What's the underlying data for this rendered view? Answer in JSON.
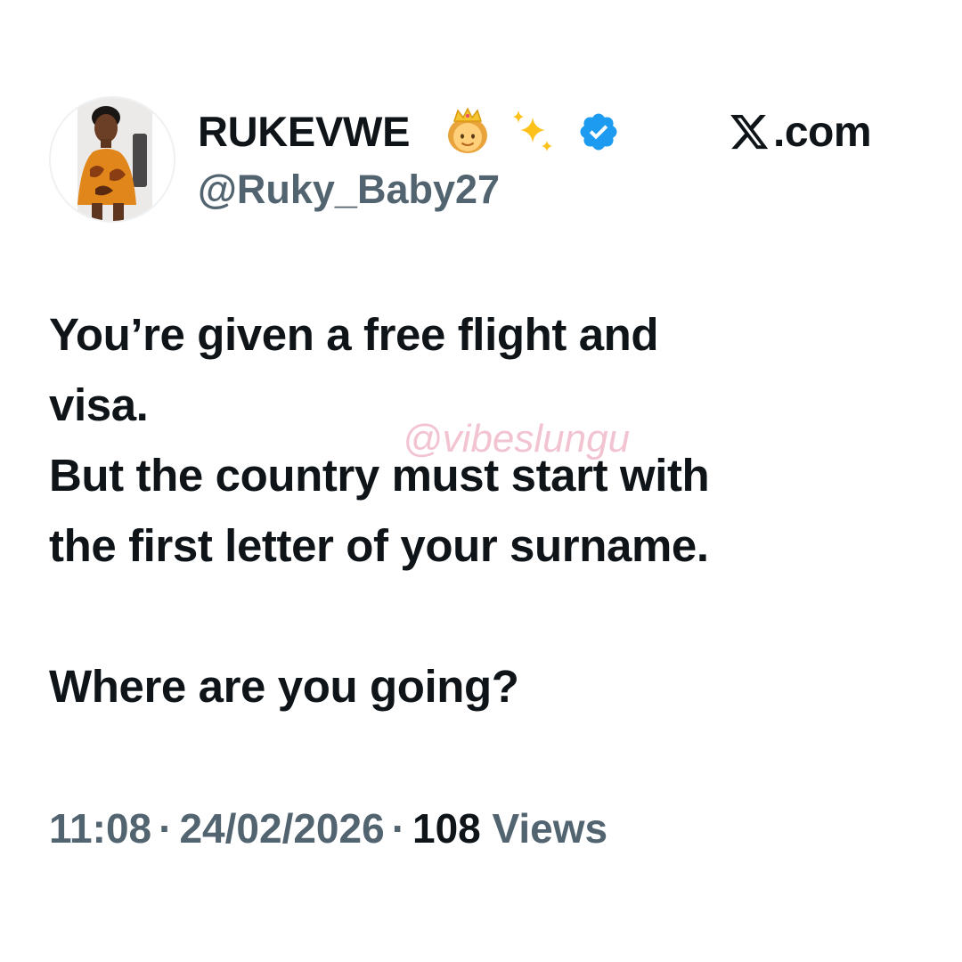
{
  "author": {
    "display_name": "RUKEVWE",
    "handle": "@Ruky_Baby27",
    "emojis": [
      "👸",
      "✨"
    ],
    "verified": true,
    "verified_badge_color": "#1d9bf0",
    "avatar_icon": "profile-photo"
  },
  "platform": {
    "label": ".com",
    "logo_icon": "x-logo-icon"
  },
  "tweet": {
    "lines": [
      "You’re given a free flight and",
      "visa.",
      "But the country must start with",
      "the first letter of your surname.",
      "",
      "Where are you going?"
    ]
  },
  "watermark": {
    "text": "@vibeslungu",
    "color": "#e792aa"
  },
  "meta": {
    "time": "11:08",
    "separator": "·",
    "date": "24/02/2026",
    "views_count": "108",
    "views_label": "Views"
  },
  "colors": {
    "text_primary": "#0f1419",
    "text_secondary": "#536471",
    "background": "#ffffff"
  }
}
